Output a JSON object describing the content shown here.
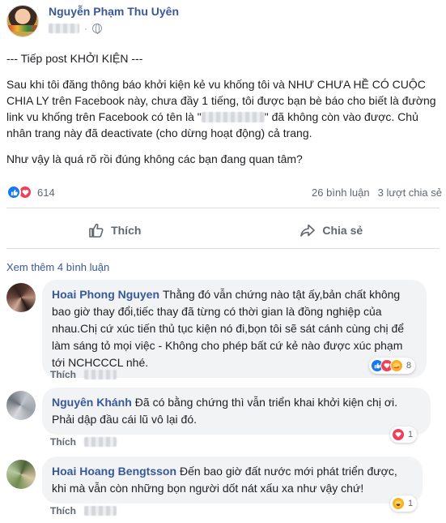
{
  "post": {
    "author": "Nguyễn Phạm Thu Uyên",
    "paragraphs": [
      "--- Tiếp post KHỞI KIỆN ---",
      "Sau khi tôi đăng thông báo khởi kiện kẻ vu khống tôi và NHƯ CHƯA HỀ CÓ CUỘC CHIA LY trên Facebook này, chưa đầy 1 tiếng, tôi được bạn bè báo cho biết là đường link vu khống trên Facebook có tên là \"",
      "\" đã không còn vào được. Chủ nhân trang này đã deactivate (cho dừng hoạt động) cả trang.",
      "Như vậy là quá rõ rồi đúng không các bạn đang quan tâm?"
    ],
    "reaction_count": "614",
    "comments_count": "26 bình luận",
    "shares_count": "3 lượt chia sẻ",
    "icons": {
      "like": "thumbs-up-icon",
      "love": "heart-icon",
      "globe": "globe-icon",
      "share": "share-arrow-icon"
    },
    "colors": {
      "link": "#385898",
      "like": "#1877f2",
      "love": "#f33e58"
    }
  },
  "actions": {
    "like_label": "Thích",
    "share_label": "Chia sẻ"
  },
  "see_more": "Xem thêm 4 bình luận",
  "comments": [
    {
      "name": "Hoai Phong Nguyen",
      "text": "Thằng đó vẫn chứng nào tật ấy,bản chất không bao giờ thay đổi,tiếc thay đã từng có thời gian là đồng nghiệp của nhau.Chị cứ xúc tiến thủ tục kiện nó đi,bọn tôi sẽ sát cánh cùng chị để làm sáng tỏ mọi việc - Không cho phép bất cứ kẻ nào được xúc phạm tới NCHCCCL nhé.",
      "like_label": "Thích",
      "reaction_count": "8"
    },
    {
      "name": "Nguyên Khánh",
      "text": "Đã có bằng chứng thì vẫn triển khai khởi kiện chị ơi. Phải dập đầu cái lũ vô lại đó.",
      "like_label": "Thích",
      "reaction_count": "1"
    },
    {
      "name": "Hoai Hoang Bengtsson",
      "text": "Đến bao giờ đất nước mới phát triển được, khi mà vẫn còn những bọn người dốt nát xấu xa như vậy chứ!",
      "like_label": "Thích",
      "reaction_count": "1"
    }
  ]
}
